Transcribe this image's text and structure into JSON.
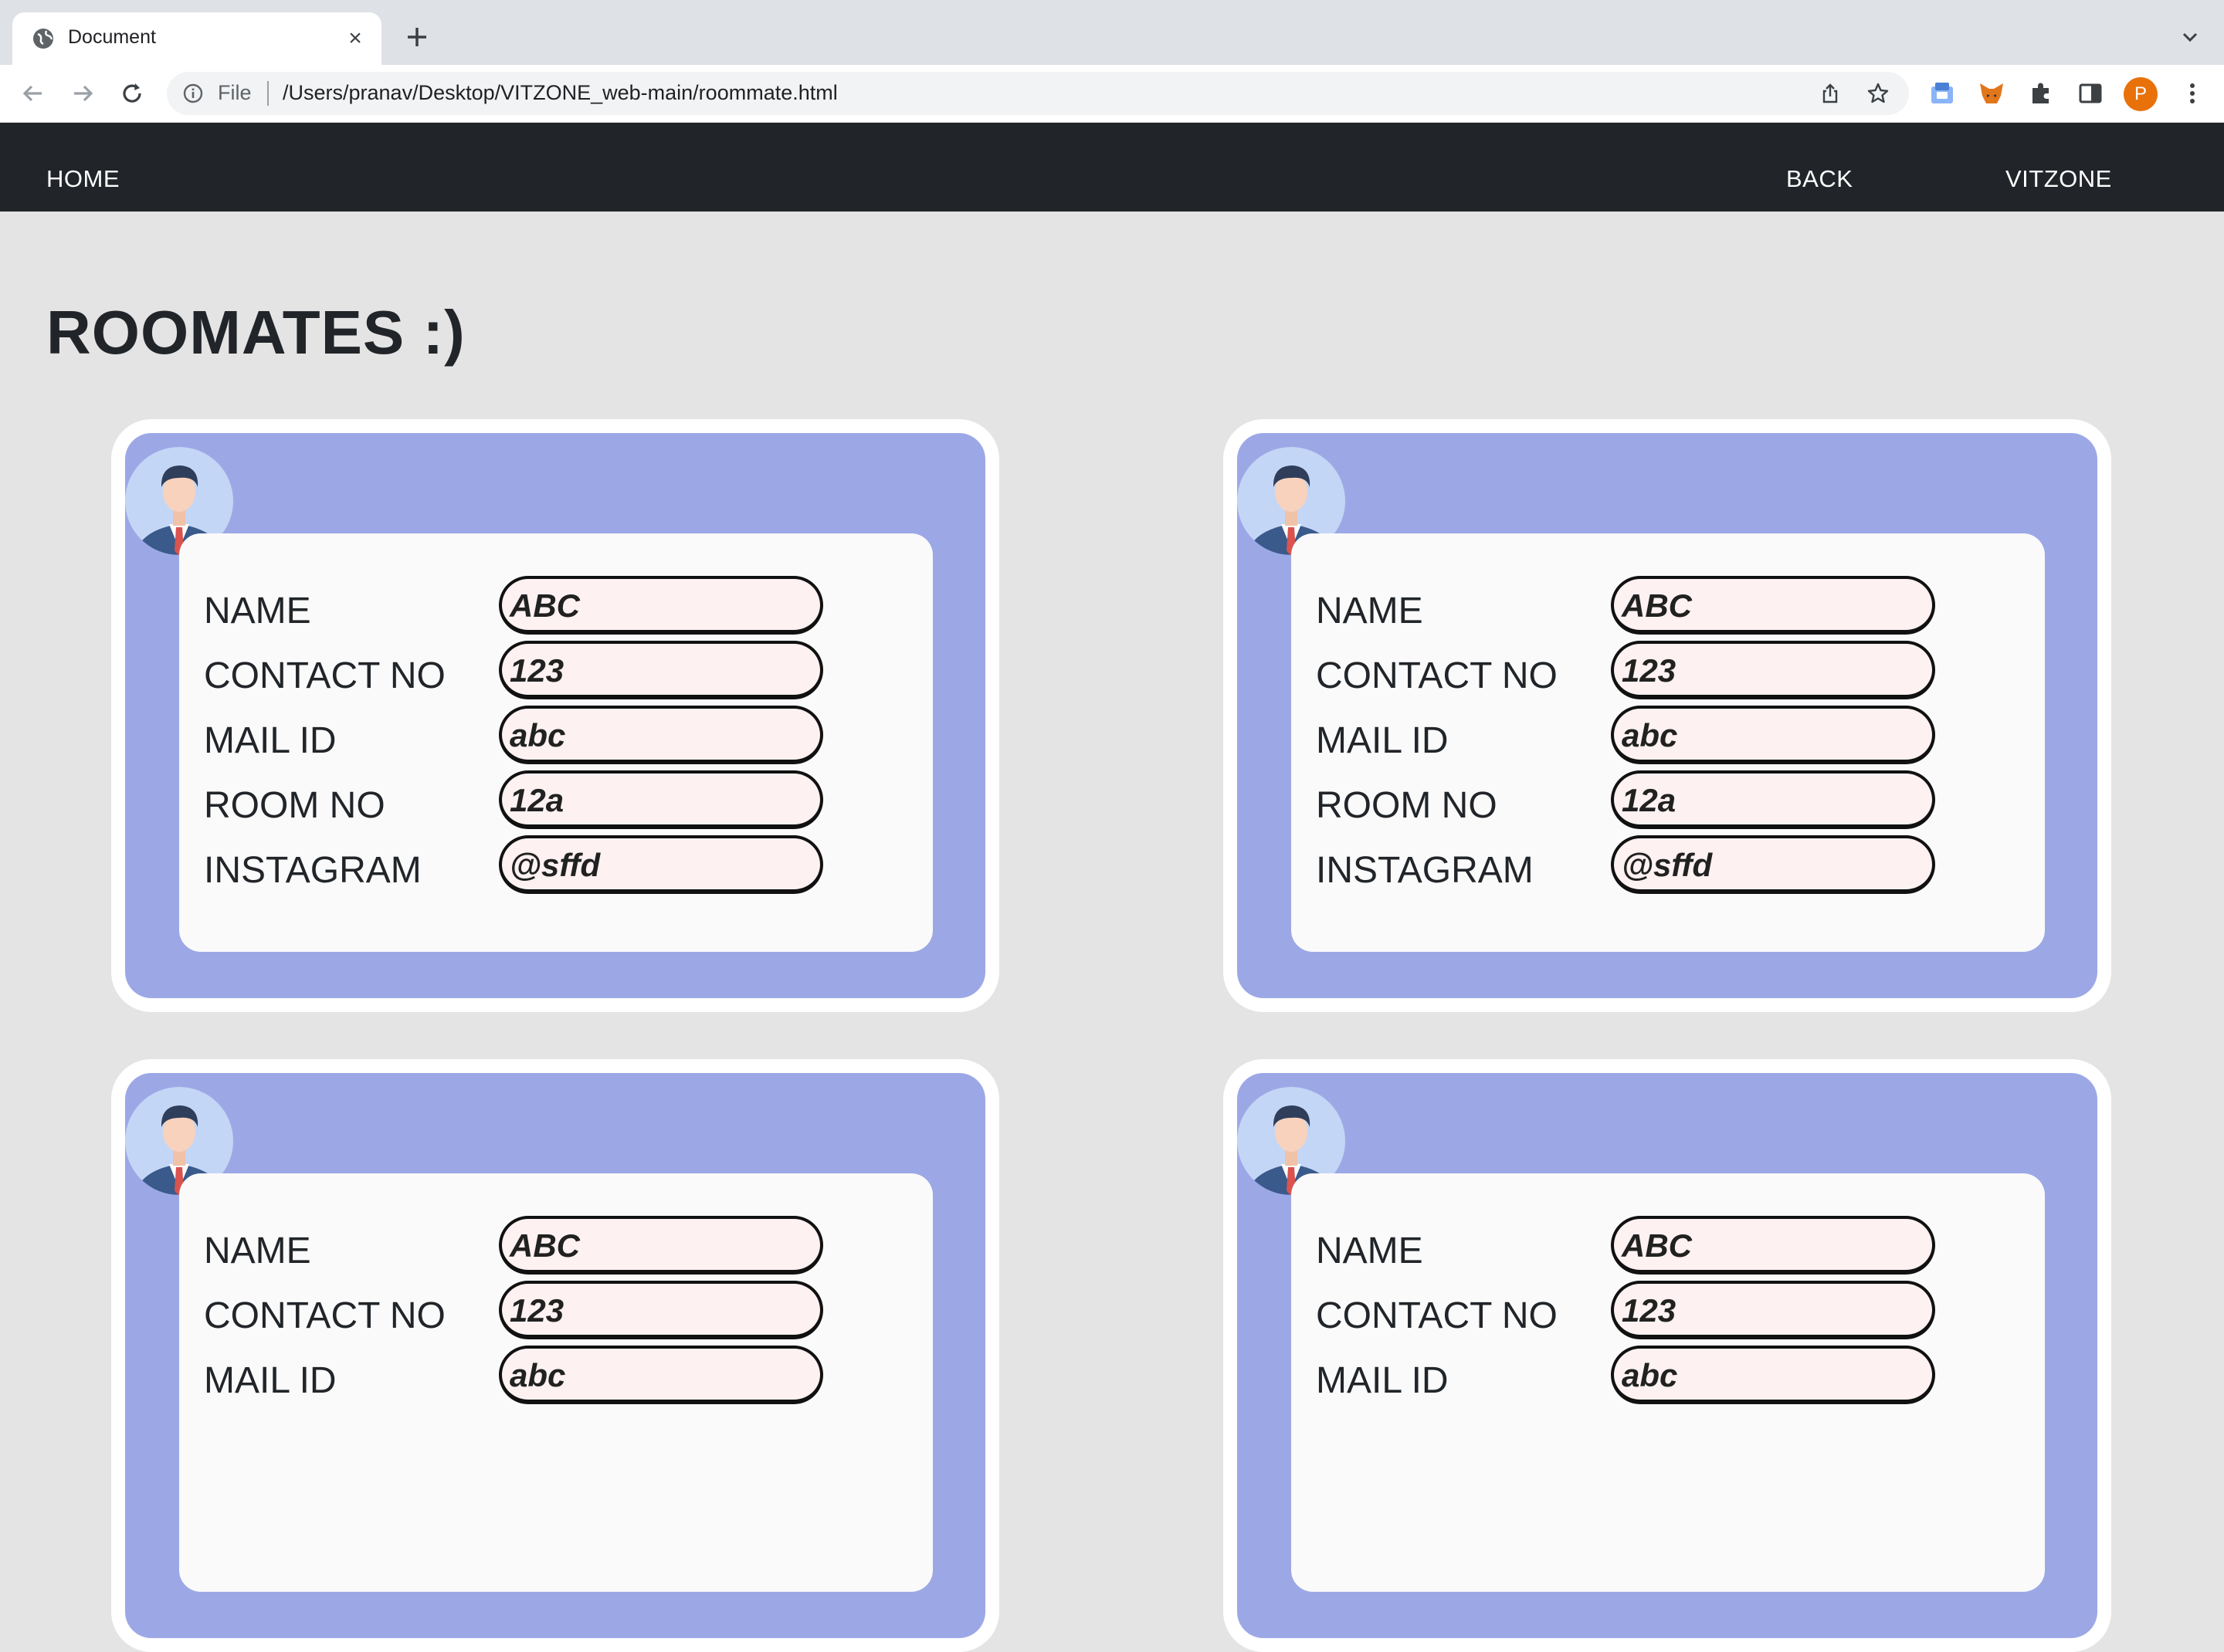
{
  "browser": {
    "tab_title": "Document",
    "tab_close": "×",
    "scheme": "File",
    "url": "/Users/pranav/Desktop/VITZONE_web-main/roommate.html",
    "profile_initial": "P"
  },
  "nav": {
    "home": "HOME",
    "back": "BACK",
    "brand": "VITZONE"
  },
  "page": {
    "title": "ROOMATES :)"
  },
  "labels": {
    "name": "NAME",
    "contact": "CONTACT NO",
    "mail": "MAIL ID",
    "room": "ROOM NO",
    "instagram": "INSTAGRAM"
  },
  "roommates": [
    {
      "name": "ABC",
      "contact": "123",
      "mail": "abc",
      "room": "12a",
      "instagram": "@sffd"
    },
    {
      "name": "ABC",
      "contact": "123",
      "mail": "abc",
      "room": "12a",
      "instagram": "@sffd"
    },
    {
      "name": "ABC",
      "contact": "123",
      "mail": "abc"
    },
    {
      "name": "ABC",
      "contact": "123",
      "mail": "abc"
    }
  ],
  "colors": {
    "nav_bg": "#212529",
    "card_accent": "#9ca8e6",
    "field_bg": "#fdf1f1",
    "page_bg": "#e4e4e4"
  }
}
